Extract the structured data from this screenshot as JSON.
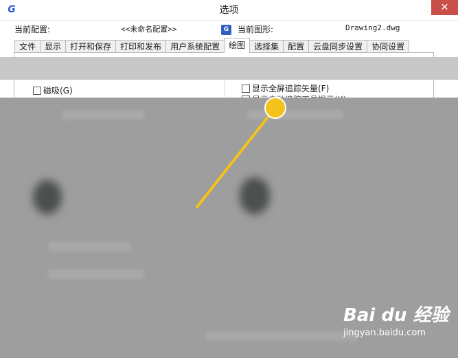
{
  "window": {
    "logo_glyph": "G",
    "title": "选项",
    "close_glyph": "✕"
  },
  "header": {
    "config_label": "当前配置:",
    "config_value": "<<未命名配置>>",
    "drawing_icon": "dwg-file-icon",
    "drawing_label": "当前图形:",
    "drawing_value": "Drawing2.dwg"
  },
  "tabs": [
    {
      "label": "文件",
      "active": false
    },
    {
      "label": "显示",
      "active": false
    },
    {
      "label": "打开和保存",
      "active": false
    },
    {
      "label": "打印和发布",
      "active": false
    },
    {
      "label": "用户系统配置",
      "active": false
    },
    {
      "label": "绘图",
      "active": true
    },
    {
      "label": "选择集",
      "active": false
    },
    {
      "label": "配置",
      "active": false
    },
    {
      "label": "云盘同步设置",
      "active": false
    },
    {
      "label": "协同设置",
      "active": false
    }
  ],
  "options": {
    "magnet": {
      "label": "磁吸(G)",
      "checked": false
    },
    "fullscreen_tracking": {
      "label": "显示全屏追踪矢量(F)",
      "checked": false
    },
    "partial_text": "显示自动追踪工具提示(K)"
  },
  "watermark": {
    "brand": "Bai du 经验",
    "url": "jingyan.baidu.com"
  },
  "colors": {
    "accent": "#2a5bd7",
    "pointer": "#f5c21b",
    "close": "#c9504a",
    "blur_gray": "#9e9e9e"
  }
}
